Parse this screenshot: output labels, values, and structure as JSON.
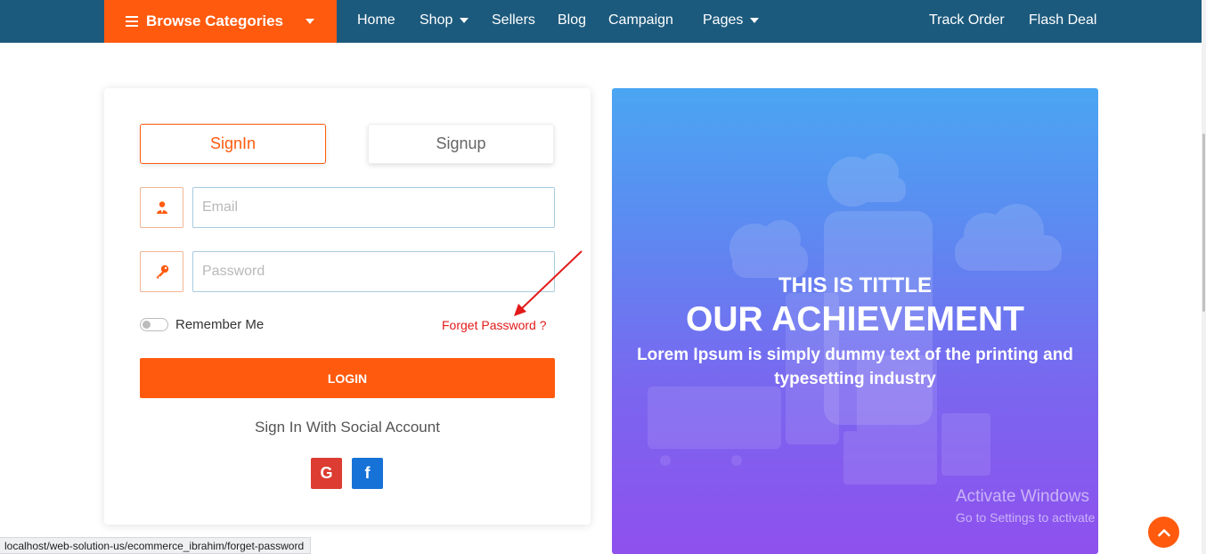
{
  "nav": {
    "browse_label": "Browse Categories",
    "items": [
      {
        "label": "Home"
      },
      {
        "label": "Shop"
      },
      {
        "label": "Sellers"
      },
      {
        "label": "Blog"
      },
      {
        "label": "Campaign"
      },
      {
        "label": "Pages"
      }
    ],
    "right_items": [
      {
        "label": "Track Order"
      },
      {
        "label": "Flash Deal"
      }
    ]
  },
  "login": {
    "tabs": [
      {
        "label": "SignIn",
        "active": true
      },
      {
        "label": "Signup",
        "active": false
      }
    ],
    "email_placeholder": "Email",
    "password_placeholder": "Password",
    "remember_label": "Remember Me",
    "forget_label": "Forget Password ?",
    "login_button": "LOGIN",
    "social_label": "Sign In With Social Account",
    "social": {
      "google": "G",
      "facebook": "f"
    }
  },
  "promo": {
    "subtitle": "THIS IS TITTLE",
    "title": "OUR ACHIEVEMENT",
    "text": "Lorem Ipsum is simply dummy text of the printing and typesetting industry"
  },
  "watermark": {
    "line1": "Activate Windows",
    "line2": "Go to Settings to activate Windows."
  },
  "status_url": "localhost/web-solution-us/ecommerce_ibrahim/forget-password",
  "colors": {
    "nav_bg": "#1c5a7d",
    "accent": "#ff5a0e",
    "annotation": "#e31a1a",
    "google": "#dc3c32",
    "facebook": "#1672d6"
  },
  "icons": [
    "hamburger-icon",
    "chevron-down-icon",
    "user-icon",
    "key-icon",
    "google-icon",
    "facebook-icon",
    "arrow-up-icon"
  ]
}
